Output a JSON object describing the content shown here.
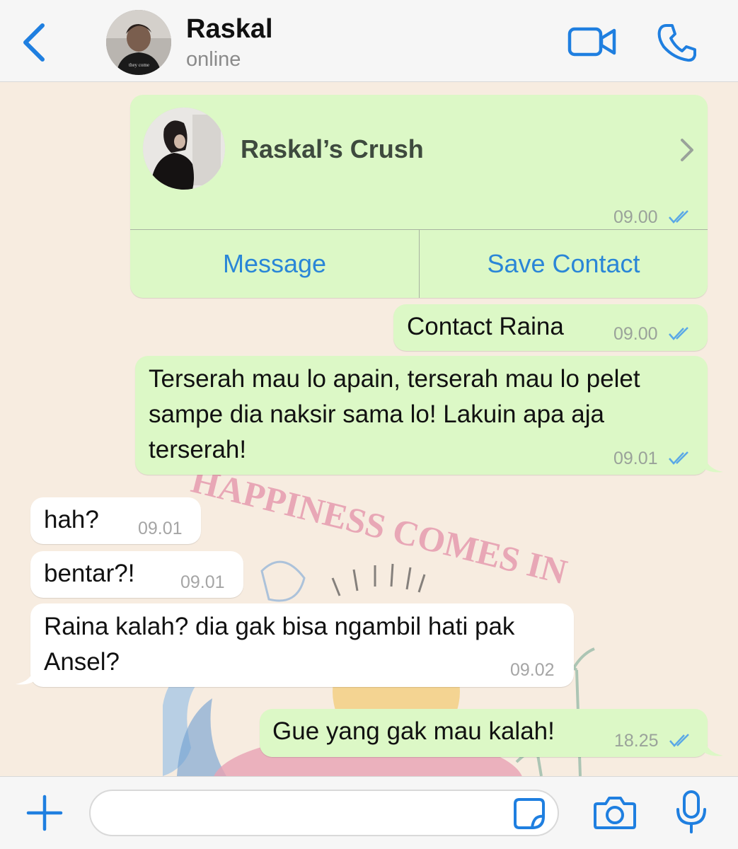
{
  "header": {
    "contact_name": "Raskal",
    "status": "online"
  },
  "messages": [
    {
      "type": "contact_card",
      "direction": "outgoing",
      "contact_name": "Raskal’s Crush",
      "time": "09.00",
      "read": true,
      "buttons": [
        "Message",
        "Save Contact"
      ]
    },
    {
      "direction": "outgoing",
      "text": "Contact Raina",
      "time": "09.00",
      "read": true
    },
    {
      "direction": "outgoing",
      "lines": [
        "Terserah mau lo apain, terserah mau lo pelet",
        "sampe dia naksir sama lo! Lakuin apa aja",
        "terserah!"
      ],
      "time": "09.01",
      "read": true
    },
    {
      "direction": "incoming",
      "text": "hah?",
      "time": "09.01"
    },
    {
      "direction": "incoming",
      "text": "bentar?!",
      "time": "09.01"
    },
    {
      "direction": "incoming",
      "lines": [
        "Raina kalah? dia gak bisa ngambil hati pak",
        "Ansel?"
      ],
      "time": "09.02"
    },
    {
      "direction": "outgoing",
      "text": "Gue yang gak mau kalah!",
      "time": "18.25",
      "read": true
    }
  ],
  "wallpaper_text": "HAPPINESS COMES IN",
  "input": {
    "placeholder": ""
  },
  "colors": {
    "accent": "#1f7fe0",
    "outgoing_bubble": "#dcf8c6",
    "incoming_bubble": "#ffffff",
    "chat_background": "#f7ece0",
    "read_ticks": "#5aa8e6"
  },
  "icons": [
    "back-chevron-icon",
    "video-call-icon",
    "phone-icon",
    "chevron-right-icon",
    "double-check-icon",
    "plus-icon",
    "sticker-icon",
    "camera-icon",
    "microphone-icon"
  ]
}
